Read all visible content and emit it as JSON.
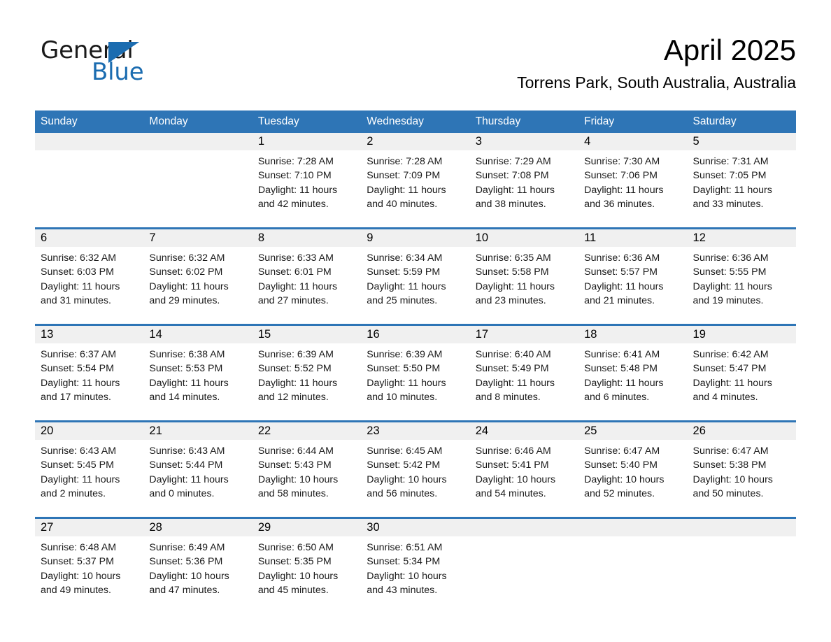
{
  "brand": {
    "word_one": "General",
    "word_two": "Blue",
    "accent_color": "#1b6cb0",
    "triangle_icon": "triangle-icon"
  },
  "header": {
    "title": "April 2025",
    "subtitle": "Torrens Park, South Australia, Australia"
  },
  "theme": {
    "header_band": "#2e75b6",
    "day_band": "#f0f0f0",
    "row_divider": "#2e75b6",
    "text": "#000000"
  },
  "weekday_headers": [
    "Sunday",
    "Monday",
    "Tuesday",
    "Wednesday",
    "Thursday",
    "Friday",
    "Saturday"
  ],
  "weeks": [
    [
      {
        "day": "",
        "sunrise": "",
        "sunset": "",
        "daylight_1": "",
        "daylight_2": ""
      },
      {
        "day": "",
        "sunrise": "",
        "sunset": "",
        "daylight_1": "",
        "daylight_2": ""
      },
      {
        "day": "1",
        "sunrise": "Sunrise: 7:28 AM",
        "sunset": "Sunset: 7:10 PM",
        "daylight_1": "Daylight: 11 hours",
        "daylight_2": "and 42 minutes."
      },
      {
        "day": "2",
        "sunrise": "Sunrise: 7:28 AM",
        "sunset": "Sunset: 7:09 PM",
        "daylight_1": "Daylight: 11 hours",
        "daylight_2": "and 40 minutes."
      },
      {
        "day": "3",
        "sunrise": "Sunrise: 7:29 AM",
        "sunset": "Sunset: 7:08 PM",
        "daylight_1": "Daylight: 11 hours",
        "daylight_2": "and 38 minutes."
      },
      {
        "day": "4",
        "sunrise": "Sunrise: 7:30 AM",
        "sunset": "Sunset: 7:06 PM",
        "daylight_1": "Daylight: 11 hours",
        "daylight_2": "and 36 minutes."
      },
      {
        "day": "5",
        "sunrise": "Sunrise: 7:31 AM",
        "sunset": "Sunset: 7:05 PM",
        "daylight_1": "Daylight: 11 hours",
        "daylight_2": "and 33 minutes."
      }
    ],
    [
      {
        "day": "6",
        "sunrise": "Sunrise: 6:32 AM",
        "sunset": "Sunset: 6:03 PM",
        "daylight_1": "Daylight: 11 hours",
        "daylight_2": "and 31 minutes."
      },
      {
        "day": "7",
        "sunrise": "Sunrise: 6:32 AM",
        "sunset": "Sunset: 6:02 PM",
        "daylight_1": "Daylight: 11 hours",
        "daylight_2": "and 29 minutes."
      },
      {
        "day": "8",
        "sunrise": "Sunrise: 6:33 AM",
        "sunset": "Sunset: 6:01 PM",
        "daylight_1": "Daylight: 11 hours",
        "daylight_2": "and 27 minutes."
      },
      {
        "day": "9",
        "sunrise": "Sunrise: 6:34 AM",
        "sunset": "Sunset: 5:59 PM",
        "daylight_1": "Daylight: 11 hours",
        "daylight_2": "and 25 minutes."
      },
      {
        "day": "10",
        "sunrise": "Sunrise: 6:35 AM",
        "sunset": "Sunset: 5:58 PM",
        "daylight_1": "Daylight: 11 hours",
        "daylight_2": "and 23 minutes."
      },
      {
        "day": "11",
        "sunrise": "Sunrise: 6:36 AM",
        "sunset": "Sunset: 5:57 PM",
        "daylight_1": "Daylight: 11 hours",
        "daylight_2": "and 21 minutes."
      },
      {
        "day": "12",
        "sunrise": "Sunrise: 6:36 AM",
        "sunset": "Sunset: 5:55 PM",
        "daylight_1": "Daylight: 11 hours",
        "daylight_2": "and 19 minutes."
      }
    ],
    [
      {
        "day": "13",
        "sunrise": "Sunrise: 6:37 AM",
        "sunset": "Sunset: 5:54 PM",
        "daylight_1": "Daylight: 11 hours",
        "daylight_2": "and 17 minutes."
      },
      {
        "day": "14",
        "sunrise": "Sunrise: 6:38 AM",
        "sunset": "Sunset: 5:53 PM",
        "daylight_1": "Daylight: 11 hours",
        "daylight_2": "and 14 minutes."
      },
      {
        "day": "15",
        "sunrise": "Sunrise: 6:39 AM",
        "sunset": "Sunset: 5:52 PM",
        "daylight_1": "Daylight: 11 hours",
        "daylight_2": "and 12 minutes."
      },
      {
        "day": "16",
        "sunrise": "Sunrise: 6:39 AM",
        "sunset": "Sunset: 5:50 PM",
        "daylight_1": "Daylight: 11 hours",
        "daylight_2": "and 10 minutes."
      },
      {
        "day": "17",
        "sunrise": "Sunrise: 6:40 AM",
        "sunset": "Sunset: 5:49 PM",
        "daylight_1": "Daylight: 11 hours",
        "daylight_2": "and 8 minutes."
      },
      {
        "day": "18",
        "sunrise": "Sunrise: 6:41 AM",
        "sunset": "Sunset: 5:48 PM",
        "daylight_1": "Daylight: 11 hours",
        "daylight_2": "and 6 minutes."
      },
      {
        "day": "19",
        "sunrise": "Sunrise: 6:42 AM",
        "sunset": "Sunset: 5:47 PM",
        "daylight_1": "Daylight: 11 hours",
        "daylight_2": "and 4 minutes."
      }
    ],
    [
      {
        "day": "20",
        "sunrise": "Sunrise: 6:43 AM",
        "sunset": "Sunset: 5:45 PM",
        "daylight_1": "Daylight: 11 hours",
        "daylight_2": "and 2 minutes."
      },
      {
        "day": "21",
        "sunrise": "Sunrise: 6:43 AM",
        "sunset": "Sunset: 5:44 PM",
        "daylight_1": "Daylight: 11 hours",
        "daylight_2": "and 0 minutes."
      },
      {
        "day": "22",
        "sunrise": "Sunrise: 6:44 AM",
        "sunset": "Sunset: 5:43 PM",
        "daylight_1": "Daylight: 10 hours",
        "daylight_2": "and 58 minutes."
      },
      {
        "day": "23",
        "sunrise": "Sunrise: 6:45 AM",
        "sunset": "Sunset: 5:42 PM",
        "daylight_1": "Daylight: 10 hours",
        "daylight_2": "and 56 minutes."
      },
      {
        "day": "24",
        "sunrise": "Sunrise: 6:46 AM",
        "sunset": "Sunset: 5:41 PM",
        "daylight_1": "Daylight: 10 hours",
        "daylight_2": "and 54 minutes."
      },
      {
        "day": "25",
        "sunrise": "Sunrise: 6:47 AM",
        "sunset": "Sunset: 5:40 PM",
        "daylight_1": "Daylight: 10 hours",
        "daylight_2": "and 52 minutes."
      },
      {
        "day": "26",
        "sunrise": "Sunrise: 6:47 AM",
        "sunset": "Sunset: 5:38 PM",
        "daylight_1": "Daylight: 10 hours",
        "daylight_2": "and 50 minutes."
      }
    ],
    [
      {
        "day": "27",
        "sunrise": "Sunrise: 6:48 AM",
        "sunset": "Sunset: 5:37 PM",
        "daylight_1": "Daylight: 10 hours",
        "daylight_2": "and 49 minutes."
      },
      {
        "day": "28",
        "sunrise": "Sunrise: 6:49 AM",
        "sunset": "Sunset: 5:36 PM",
        "daylight_1": "Daylight: 10 hours",
        "daylight_2": "and 47 minutes."
      },
      {
        "day": "29",
        "sunrise": "Sunrise: 6:50 AM",
        "sunset": "Sunset: 5:35 PM",
        "daylight_1": "Daylight: 10 hours",
        "daylight_2": "and 45 minutes."
      },
      {
        "day": "30",
        "sunrise": "Sunrise: 6:51 AM",
        "sunset": "Sunset: 5:34 PM",
        "daylight_1": "Daylight: 10 hours",
        "daylight_2": "and 43 minutes."
      },
      {
        "day": "",
        "sunrise": "",
        "sunset": "",
        "daylight_1": "",
        "daylight_2": ""
      },
      {
        "day": "",
        "sunrise": "",
        "sunset": "",
        "daylight_1": "",
        "daylight_2": ""
      },
      {
        "day": "",
        "sunrise": "",
        "sunset": "",
        "daylight_1": "",
        "daylight_2": ""
      }
    ]
  ]
}
